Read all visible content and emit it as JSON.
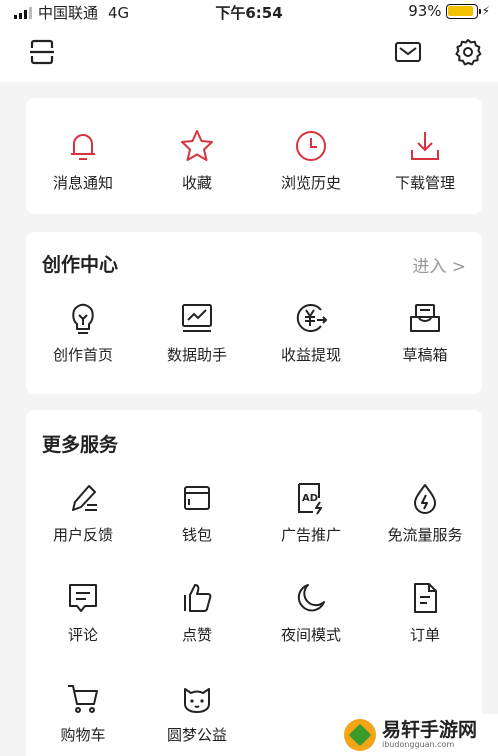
{
  "status_bar": {
    "carrier": "中国联通",
    "network": "4G",
    "time": "下午6:54",
    "battery": "93%",
    "battery_level": 0.93
  },
  "header": {
    "scan_icon": "scan-icon",
    "mail_icon": "mail-icon",
    "settings_icon": "gear-icon"
  },
  "quick_actions": [
    {
      "label": "消息通知",
      "icon": "bell-icon",
      "color": "#d8333f"
    },
    {
      "label": "收藏",
      "icon": "star-icon",
      "color": "#d8333f"
    },
    {
      "label": "浏览历史",
      "icon": "clock-icon",
      "color": "#d8333f"
    },
    {
      "label": "下载管理",
      "icon": "download-icon",
      "color": "#d8333f"
    }
  ],
  "creation_center": {
    "title": "创作中心",
    "enter_label": "进入 >",
    "items": [
      {
        "label": "创作首页",
        "icon": "lightbulb-icon"
      },
      {
        "label": "数据助手",
        "icon": "chart-monitor-icon"
      },
      {
        "label": "收益提现",
        "icon": "yuan-transfer-icon"
      },
      {
        "label": "草稿箱",
        "icon": "inbox-icon"
      }
    ]
  },
  "more_services": {
    "title": "更多服务",
    "items": [
      {
        "label": "用户反馈",
        "icon": "pen-icon"
      },
      {
        "label": "钱包",
        "icon": "wallet-icon"
      },
      {
        "label": "广告推广",
        "icon": "ad-icon"
      },
      {
        "label": "免流量服务",
        "icon": "water-drop-icon"
      },
      {
        "label": "评论",
        "icon": "comment-icon"
      },
      {
        "label": "点赞",
        "icon": "thumbs-up-icon"
      },
      {
        "label": "夜间模式",
        "icon": "moon-icon"
      },
      {
        "label": "订单",
        "icon": "document-icon"
      },
      {
        "label": "购物车",
        "icon": "cart-icon"
      },
      {
        "label": "圆梦公益",
        "icon": "charity-cat-icon"
      }
    ]
  },
  "watermark": {
    "name": "易轩手游网",
    "url": "ibudongguan.com"
  },
  "colors": {
    "accent_red": "#d8333f",
    "icon_dark": "#222222",
    "muted": "#999999",
    "battery": "#f5c200"
  }
}
